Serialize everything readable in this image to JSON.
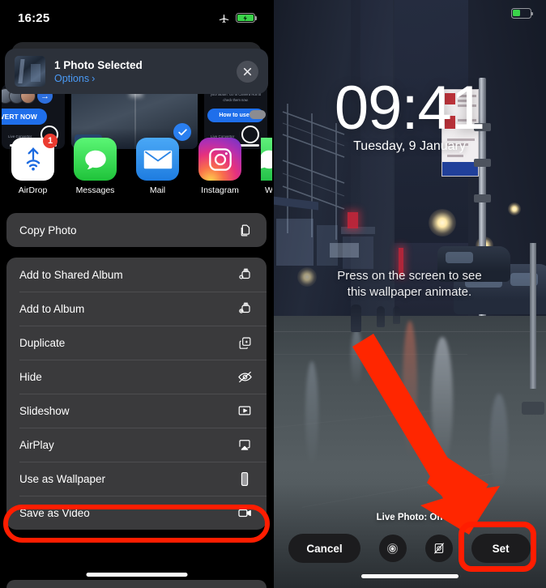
{
  "left": {
    "status": {
      "time": "16:25",
      "airplane_icon": "airplane-mode-icon",
      "battery_icon": "battery-charging-icon"
    },
    "share_sheet": {
      "title": "1 Photo Selected",
      "options_label": "Options",
      "options_chevron": "›",
      "close_icon": "close-icon"
    },
    "apps": [
      {
        "label": "AirDrop",
        "icon": "airdrop-icon",
        "badge": "1"
      },
      {
        "label": "Messages",
        "icon": "messages-icon",
        "badge": ""
      },
      {
        "label": "Mail",
        "icon": "mail-icon",
        "badge": ""
      },
      {
        "label": "Instagram",
        "icon": "instagram-icon",
        "badge": ""
      },
      {
        "label": "W",
        "icon": "whatsapp-icon",
        "badge": ""
      }
    ],
    "action_groups": [
      {
        "rows": [
          {
            "label": "Copy Photo",
            "icon": "copy-icon",
            "highlighted": false
          }
        ]
      },
      {
        "rows": [
          {
            "label": "Add to Shared Album",
            "icon": "shared-album-icon",
            "highlighted": false
          },
          {
            "label": "Add to Album",
            "icon": "add-album-icon",
            "highlighted": false
          },
          {
            "label": "Duplicate",
            "icon": "duplicate-icon",
            "highlighted": false
          },
          {
            "label": "Hide",
            "icon": "hide-eye-icon",
            "highlighted": false
          },
          {
            "label": "Slideshow",
            "icon": "slideshow-icon",
            "highlighted": false
          },
          {
            "label": "AirPlay",
            "icon": "airplay-icon",
            "highlighted": false
          },
          {
            "label": "Use as Wallpaper",
            "icon": "phone-wallpaper-icon",
            "highlighted": true
          },
          {
            "label": "Save as Video",
            "icon": "video-camera-icon",
            "highlighted": false
          }
        ]
      }
    ],
    "carousel": {
      "left_card": {
        "pill_label": "VERT NOW",
        "arrow_icon": "arrow-right-icon"
      },
      "right_card": {
        "pill_label": "How to use?",
        "caption": "The Photos have been converted to your album. Go to Camera Roll to check them now.",
        "micro_label": "Live Converter"
      },
      "left_micro_label": "Live Converter",
      "selected_check_icon": "check-circle-icon"
    }
  },
  "right": {
    "status": {
      "battery_icon": "battery-icon"
    },
    "lock_screen": {
      "time": "09:41",
      "date": "Tuesday, 9 January"
    },
    "hint_line1": "Press on the screen to see",
    "hint_line2": "this wallpaper animate.",
    "live_photo_status": "Live Photo: On",
    "buttons": {
      "cancel": "Cancel",
      "set": "Set",
      "depth_icon": "depth-effect-icon",
      "live_photo_icon": "live-photo-off-icon"
    }
  },
  "annotations": {
    "highlight_color": "#ff1d00",
    "arrow_icon": "red-arrow-down-right"
  }
}
